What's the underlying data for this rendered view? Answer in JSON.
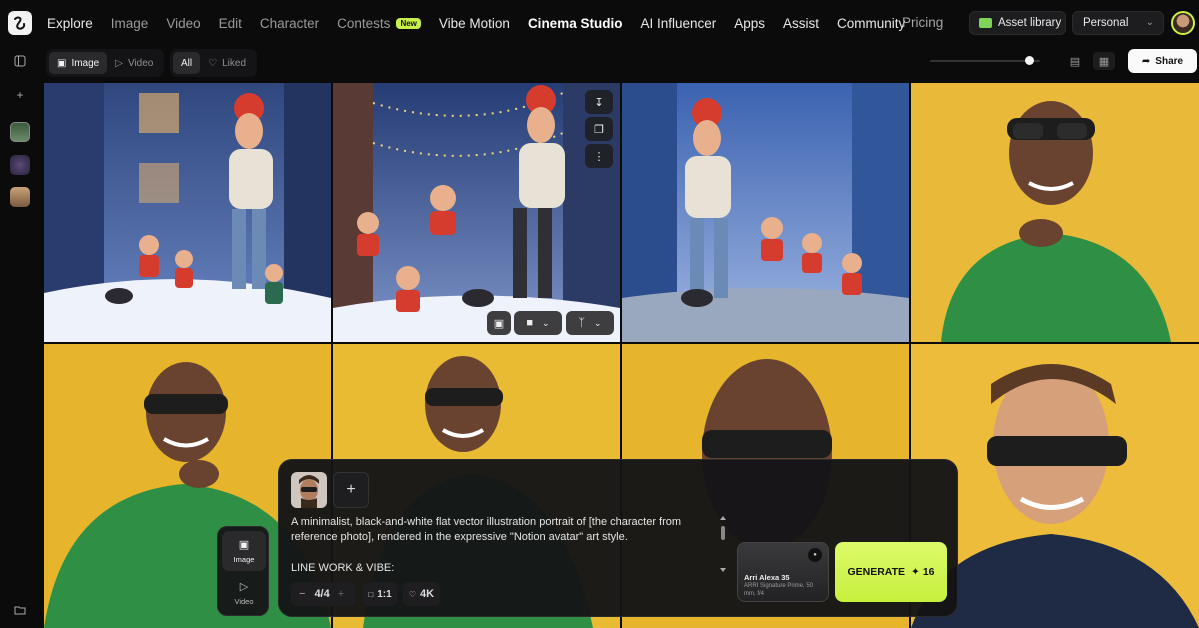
{
  "nav": {
    "items": [
      "Explore",
      "Image",
      "Video",
      "Edit",
      "Character",
      "Contests",
      "Vibe Motion",
      "Cinema Studio",
      "AI Influencer",
      "Apps",
      "Assist",
      "Community"
    ],
    "new_badge": "New",
    "pricing": "Pricing",
    "asset_library": "Asset library",
    "workspace": "Personal"
  },
  "toolbar": {
    "image": "Image",
    "video": "Video",
    "all": "All",
    "liked": "Liked",
    "share": "Share",
    "zoom_level": 0.9
  },
  "prompt": {
    "text": "A minimalist, black-and-white flat vector illustration portrait of [the character from reference photo], rendered in the expressive \"Notion avatar\" art style.",
    "subheading": "LINE WORK & VIBE:",
    "count": "4/4",
    "aspect": "1:1",
    "resolution": "4K",
    "camera_title": "Arri Alexa 35",
    "camera_sub": "ARRI Signature Prime, 50 mm, f/4",
    "generate_label": "GENERATE",
    "generate_cost": "16"
  },
  "mode": {
    "image": "Image",
    "video": "Video"
  },
  "colors": {
    "accent": "#c8f04a",
    "background": "#0b0b0c",
    "yellow_bg": "#e6b52c",
    "blue_bg": "#3a5ea8"
  },
  "icons": [
    "logo-icon",
    "folder-icon",
    "chevron-down-icon",
    "sidebar-toggle-icon",
    "plus-icon",
    "image-icon",
    "video-icon",
    "heart-icon",
    "grid-small-icon",
    "grid-large-icon",
    "share-icon",
    "download-icon",
    "copy-icon",
    "more-icon",
    "expand-icon",
    "branch-icon",
    "minus-icon",
    "sparkle-icon"
  ]
}
